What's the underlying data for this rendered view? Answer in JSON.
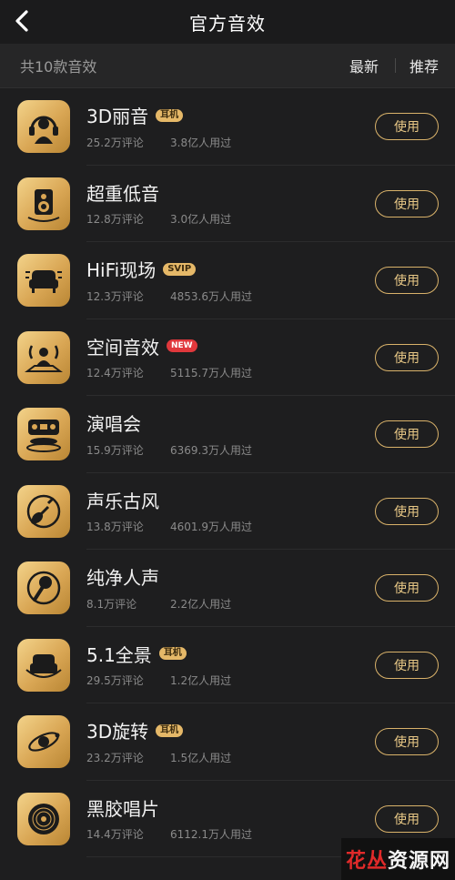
{
  "header": {
    "title": "官方音效",
    "back_icon": "chevron-left-icon"
  },
  "subbar": {
    "count_text": "共10款音效",
    "sort_latest": "最新",
    "sort_recommend": "推荐"
  },
  "items": [
    {
      "name": "3D丽音",
      "badge": "耳机",
      "badge_type": "gold",
      "comments": "25.2万评论",
      "users": "3.8亿人用过",
      "icon": "headphone-person-icon",
      "action": "使用"
    },
    {
      "name": "超重低音",
      "badge": "",
      "badge_type": "",
      "comments": "12.8万评论",
      "users": "3.0亿人用过",
      "icon": "speaker-icon",
      "action": "使用"
    },
    {
      "name": "HiFi现场",
      "badge": "SVIP",
      "badge_type": "gold",
      "comments": "12.3万评论",
      "users": "4853.6万人用过",
      "icon": "sofa-icon",
      "action": "使用"
    },
    {
      "name": "空间音效",
      "badge": "NEW",
      "badge_type": "new",
      "comments": "12.4万评论",
      "users": "5115.7万人用过",
      "icon": "spatial-person-icon",
      "action": "使用"
    },
    {
      "name": "演唱会",
      "badge": "",
      "badge_type": "",
      "comments": "15.9万评论",
      "users": "6369.3万人用过",
      "icon": "concert-stage-icon",
      "action": "使用"
    },
    {
      "name": "声乐古风",
      "badge": "",
      "badge_type": "",
      "comments": "13.8万评论",
      "users": "4601.9万人用过",
      "icon": "pipa-icon",
      "action": "使用"
    },
    {
      "name": "纯净人声",
      "badge": "",
      "badge_type": "",
      "comments": "8.1万评论",
      "users": "2.2亿人用过",
      "icon": "microphone-icon",
      "action": "使用"
    },
    {
      "name": "5.1全景",
      "badge": "耳机",
      "badge_type": "gold",
      "comments": "29.5万评论",
      "users": "1.2亿人用过",
      "icon": "surround-sofa-icon",
      "action": "使用"
    },
    {
      "name": "3D旋转",
      "badge": "耳机",
      "badge_type": "gold",
      "comments": "23.2万评论",
      "users": "1.5亿人用过",
      "icon": "orbit-icon",
      "action": "使用"
    },
    {
      "name": "黑胶唱片",
      "badge": "",
      "badge_type": "",
      "comments": "14.4万评论",
      "users": "6112.1万人用过",
      "icon": "vinyl-icon",
      "action": "使用"
    }
  ],
  "watermark": {
    "red": "花丛",
    "white": "资源网"
  },
  "colors": {
    "accent": "#e8c886",
    "icon_gold": "#d9a654",
    "background": "#1e1e1f"
  }
}
